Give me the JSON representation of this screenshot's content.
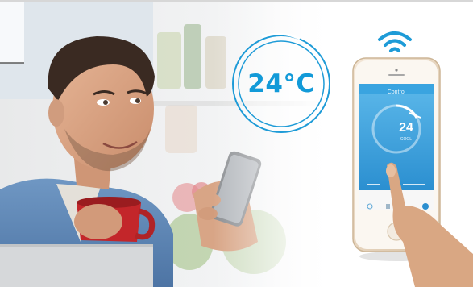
{
  "overlay": {
    "temperature_label": "24°C",
    "accent_color": "#129ad8"
  },
  "phone": {
    "screen_title": "Control",
    "temperature": "24",
    "mode": "COOL",
    "icons": [
      "power-icon",
      "menu-icon",
      "wifi-icon"
    ]
  },
  "icons": [
    "wifi-icon",
    "temperature-dial-icon",
    "phone-icon"
  ]
}
